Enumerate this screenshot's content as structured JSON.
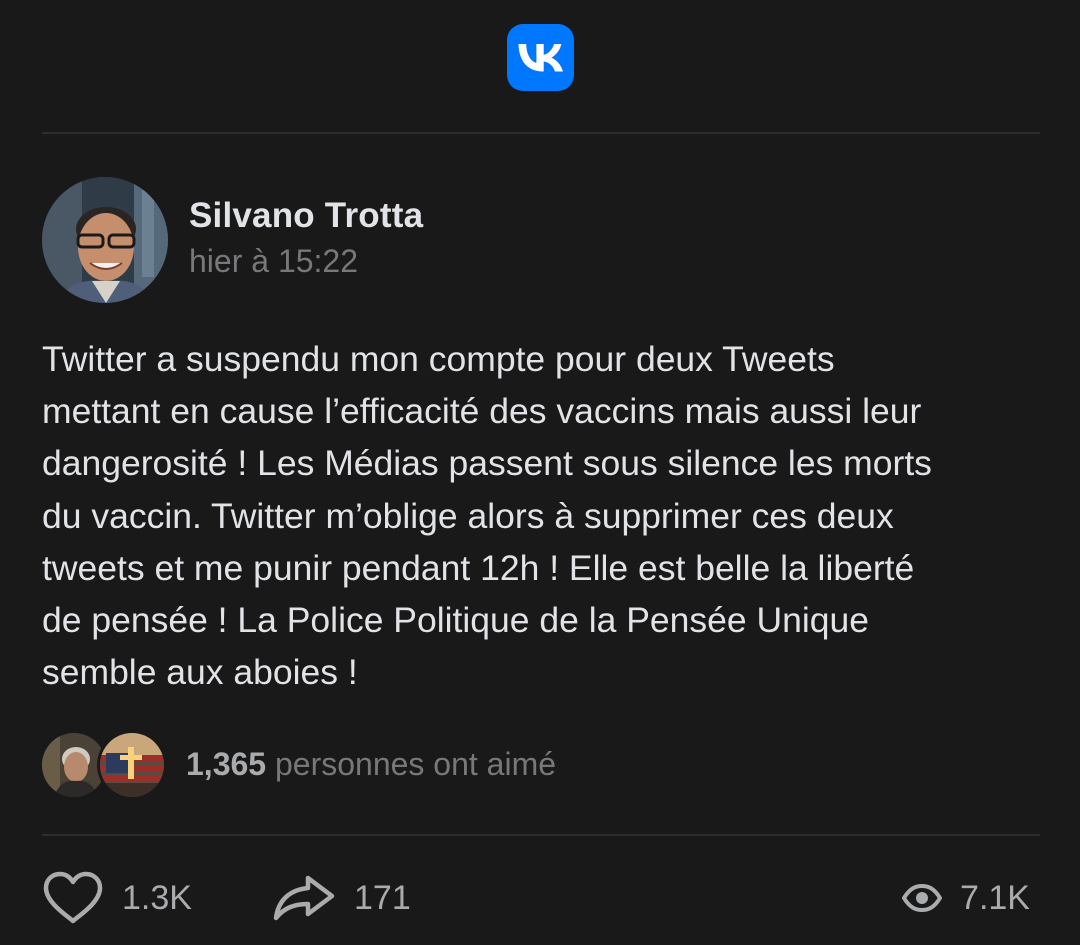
{
  "header": {
    "logo_icon": "vk-logo-icon",
    "brand_color": "#0077ff"
  },
  "post": {
    "author": "Silvano Trotta",
    "time": "hier à 15:22",
    "text": "Twitter a suspendu mon compte pour deux Tweets\nmettant en cause l’efficacité des vaccins mais aussi leur\ndangerosité ! Les Médias passent sous silence les morts\ndu vaccin. Twitter m’oblige alors à supprimer ces deux\ntweets et me punir pendant 12h ! Elle est belle la liberté\nde pensée ! La Police Politique de la Pensée Unique\nsemble aux aboies !"
  },
  "likes": {
    "count": "1,365",
    "suffix": " personnes ont aimé"
  },
  "actions": {
    "like_count": "1.3K",
    "share_count": "171",
    "views_count": "7.1K"
  }
}
